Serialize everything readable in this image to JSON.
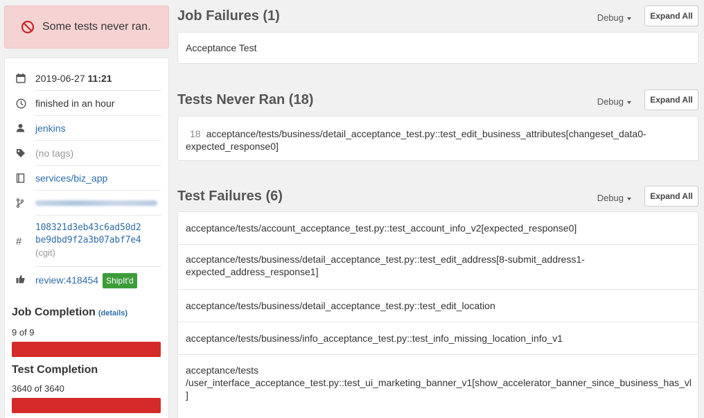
{
  "alert": {
    "text": "Some tests never ran."
  },
  "meta": {
    "date": "2019-06-27",
    "time": "11:21",
    "duration": "finished in an hour",
    "user": "jenkins",
    "tags": "(no tags)",
    "repo": "services/biz_app",
    "commit_line1": "108321d3eb43c6ad50d2",
    "commit_line2": "be9dbd9f2a3b07abf7e4",
    "commit_source": "(cgit)",
    "review": "review:418454",
    "review_badge": "ShipIt'd"
  },
  "job_completion": {
    "title": "Job Completion",
    "details": "(details)",
    "value": "9 of 9",
    "fraction": 1.0
  },
  "test_completion": {
    "title": "Test Completion",
    "value": "3640 of 3640",
    "fraction": 1.0
  },
  "sections": {
    "job_failures": {
      "title": "Job Failures (1)",
      "debug": "Debug",
      "expand": "Expand All",
      "items": [
        "Acceptance Test"
      ]
    },
    "never_ran": {
      "title": "Tests Never Ran (18)",
      "debug": "Debug",
      "expand": "Expand All",
      "count": "18",
      "item_line1": "acceptance/tests/business/detail_acceptance_test.py::test_edit_business_attributes[changeset_data0-",
      "item_line2": "expected_response0]"
    },
    "test_failures": {
      "title": "Test Failures (6)",
      "debug": "Debug",
      "expand": "Expand All",
      "items": [
        {
          "l1": "acceptance/tests/account_acceptance_test.py::test_account_info_v2[expected_response0]",
          "l2": "",
          "l3": ""
        },
        {
          "l1": "acceptance/tests/business/detail_acceptance_test.py::test_edit_address[8-submit_address1-",
          "l2": "expected_address_response1]",
          "l3": ""
        },
        {
          "l1": "acceptance/tests/business/detail_acceptance_test.py::test_edit_location",
          "l2": "",
          "l3": ""
        },
        {
          "l1": "acceptance/tests/business/info_acceptance_test.py::test_info_missing_location_info_v1",
          "l2": "",
          "l3": ""
        },
        {
          "l1": "acceptance/tests",
          "l2": "/user_interface_acceptance_test.py::test_ui_marketing_banner_v1[show_accelerator_banner_since_business_has_vl",
          "l3": "]"
        }
      ]
    }
  }
}
